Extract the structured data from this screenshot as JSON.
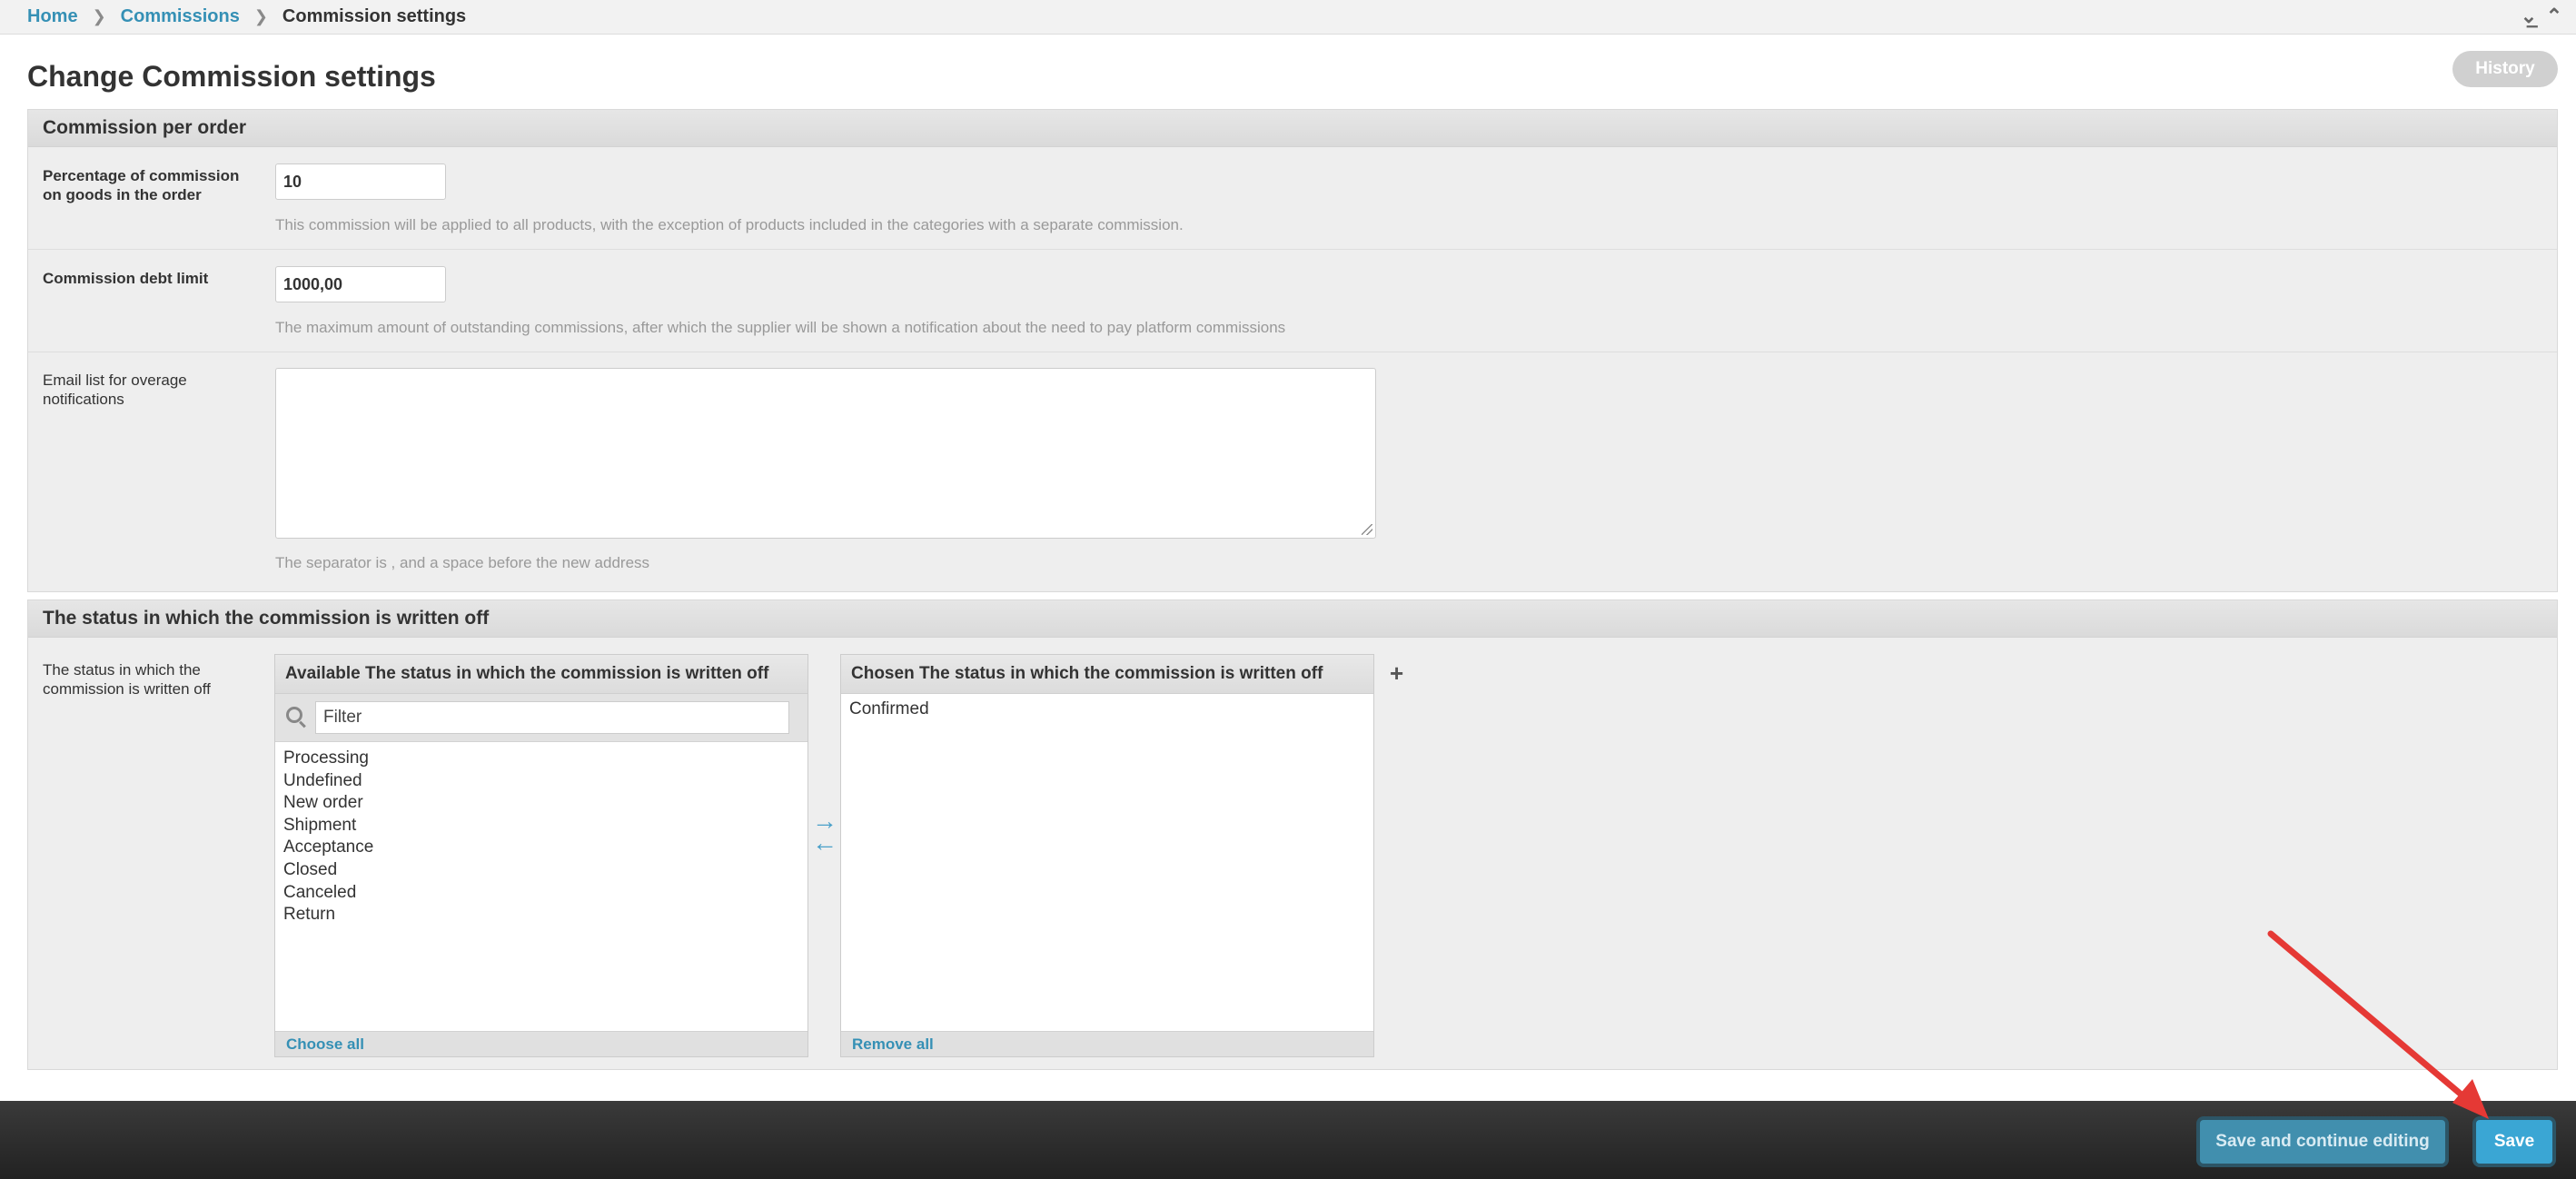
{
  "breadcrumb": {
    "home": "Home",
    "section": "Commissions",
    "current": "Commission settings"
  },
  "page": {
    "title": "Change Commission settings",
    "history_label": "History"
  },
  "fieldset_commission": {
    "title": "Commission per order",
    "percentage_label": "Percentage of commission on goods in the order",
    "percentage_value": "10",
    "percentage_help": "This commission will be applied to all products, with the exception of products included in the categories with a separate commission.",
    "debt_label": "Commission debt limit",
    "debt_value": "1000,00",
    "debt_help": "The maximum amount of outstanding commissions, after which the supplier will be shown a notification about the need to pay platform commissions",
    "email_label": "Email list for overage notifications",
    "email_value": "",
    "email_help": "The separator is , and a space before the new address"
  },
  "fieldset_status": {
    "title": "The status in which the commission is written off",
    "field_label": "The status in which the commission is written off",
    "available_header": "Available The status in which the commission is written off",
    "filter_placeholder": "Filter",
    "available_options": [
      "Processing",
      "Undefined",
      "New order",
      "Shipment",
      "Acceptance",
      "Closed",
      "Canceled",
      "Return"
    ],
    "choose_all": "Choose all",
    "chosen_header": "Chosen The status in which the commission is written off",
    "chosen_options": [
      "Confirmed"
    ],
    "remove_all": "Remove all",
    "add_symbol": "+"
  },
  "submit": {
    "continue_label": "Save and continue editing",
    "save_label": "Save"
  },
  "colors": {
    "link": "#3590b5",
    "save_button": "#3aa6d4",
    "annotation_arrow": "#e53935"
  }
}
